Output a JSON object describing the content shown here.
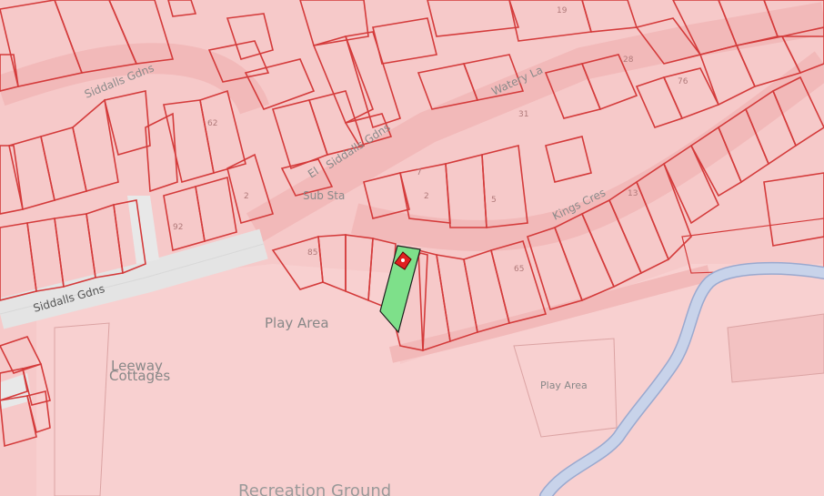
{
  "map": {
    "labels": {
      "siddalls_gdns_top": "Siddalls Gdns",
      "siddalls_gdns_left": "Siddalls Gdns",
      "el_siddalls_gdns": "El",
      "siddalls_gdns_mid": "Siddalls Gdns",
      "watery_lane": "Watery La",
      "sub_sta": "Sub Sta",
      "kings_cres": "Kings Cres",
      "play_area_main": "Play Area",
      "play_area_small": "Play Area",
      "leeway_line1": "Leeway",
      "leeway_line2": "Cottages",
      "recreation_ground": "Recreation Ground"
    },
    "house_numbers": [
      "19",
      "28",
      "31",
      "76",
      "85",
      "65",
      "92",
      "62",
      "2",
      "5",
      "7",
      "13",
      "2"
    ],
    "colors": {
      "background": "#f6c9c9",
      "parcel_outline": "#d43b3b",
      "road_fill": "#f2bdbd",
      "main_road_fill": "#e6e6e6",
      "river_fill": "#c8d3ea",
      "river_outline": "#9aa9cf",
      "selected_parcel": "#7ee08a",
      "marker": "#e02020"
    }
  }
}
